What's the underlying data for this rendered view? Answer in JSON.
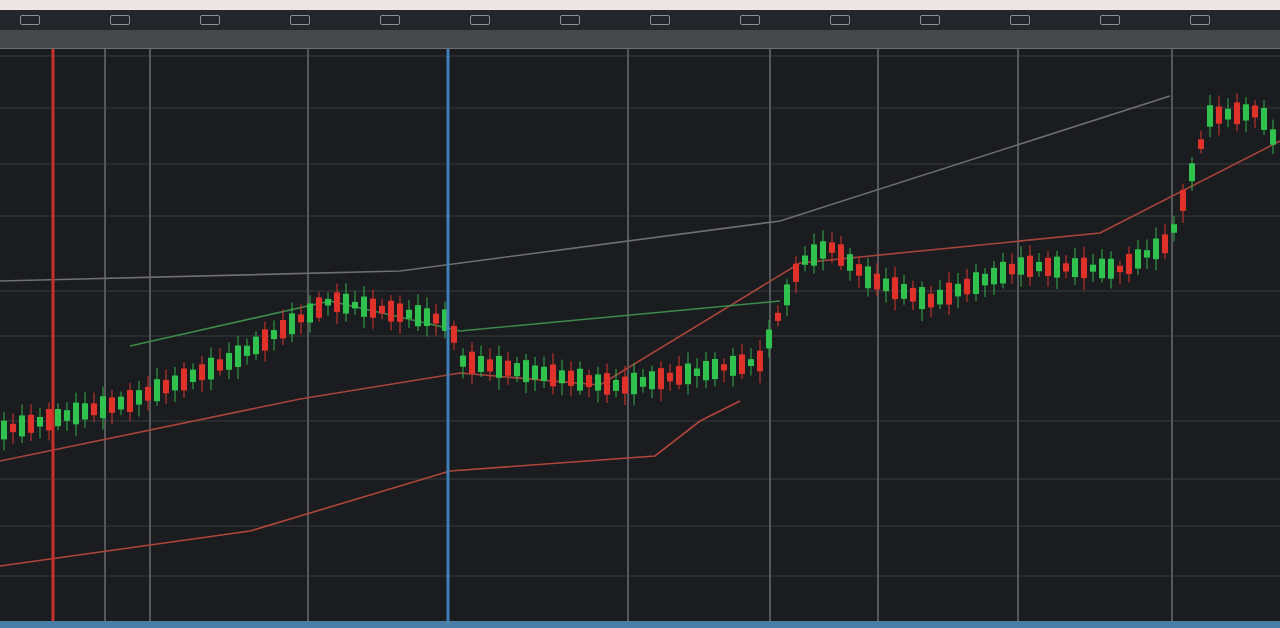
{
  "chart": {
    "kind": "candlestick",
    "markers": [
      {
        "color": "#c8302c"
      },
      {
        "color": "#3f7fb8"
      }
    ]
  }
}
